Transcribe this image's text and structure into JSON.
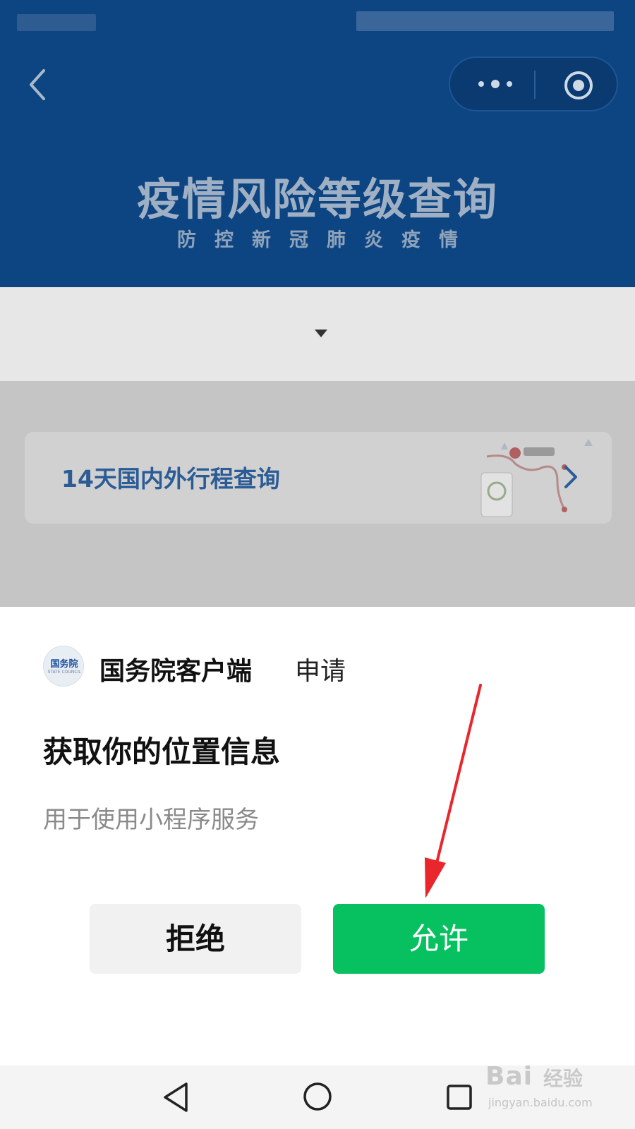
{
  "header": {
    "title": "疫情风险等级查询",
    "subtitle": "防控新冠肺炎疫情",
    "color": "#0d4482"
  },
  "card": {
    "label": "14天国内外行程查询"
  },
  "dialog": {
    "app_name": "国务院客户端",
    "request_word": "申请",
    "title": "获取你的位置信息",
    "description": "用于使用小程序服务",
    "deny_label": "拒绝",
    "allow_label": "允许",
    "logo_text": "国务院",
    "logo_subtext": "STATE COUNCIL",
    "allow_color": "#07c160"
  },
  "watermark": {
    "logo": "Bai",
    "brand": "经验",
    "url": "jingyan.baidu.com"
  }
}
